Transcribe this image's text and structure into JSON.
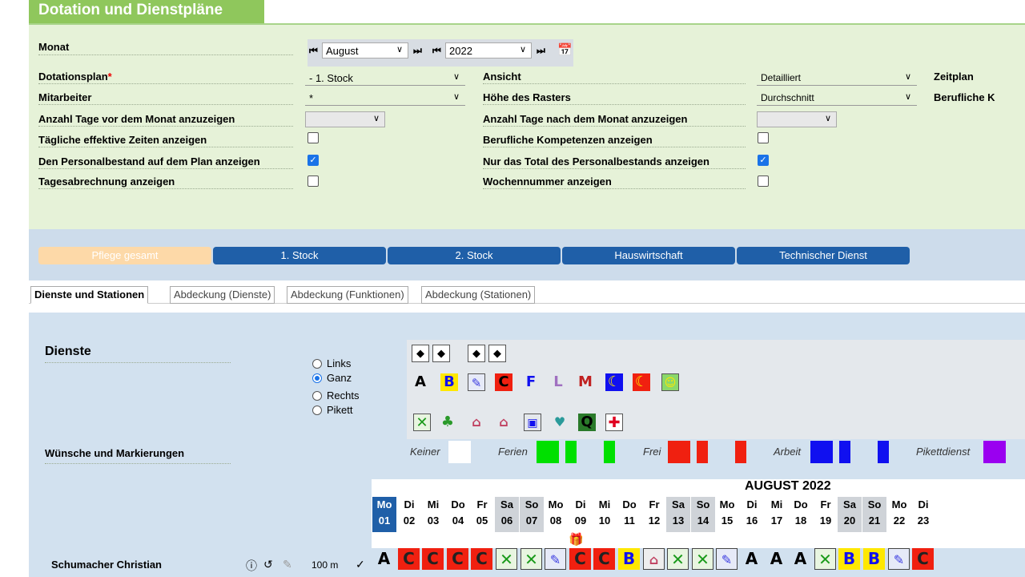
{
  "title": "Dotation und Dienstpläne",
  "filters": {
    "month_label": "Monat",
    "month_value": "August",
    "year_value": "2022",
    "plan_label": "Dotationsplan",
    "plan_required": "*",
    "plan_value": "- 1. Stock",
    "staff_label": "Mitarbeiter",
    "staff_value": "*",
    "days_before_label": "Anzahl Tage vor dem Monat anzuzeigen",
    "daily_times_label": "Tägliche effektive Zeiten anzeigen",
    "headcount_label": "Den Personalbestand auf dem Plan anzeigen",
    "daily_billing_label": "Tagesabrechnung anzeigen",
    "view_label": "Ansicht",
    "view_value": "Detailliert",
    "grid_height_label": "Höhe des Rasters",
    "grid_height_value": "Durchschnitt",
    "days_after_label": "Anzahl Tage nach dem Monat anzuzeigen",
    "competences_label": "Berufliche Kompetenzen anzeigen",
    "total_only_label": "Nur das Total des Personalbestands anzeigen",
    "week_number_label": "Wochennummer anzeigen",
    "schedule_label": "Zeitplan",
    "professional_label": "Berufliche K"
  },
  "groups": [
    "Pflege gesamt",
    "1. Stock",
    "2. Stock",
    "Hauswirtschaft",
    "Technischer Dienst"
  ],
  "tabs": [
    "Dienste und Stationen",
    "Abdeckung (Dienste)",
    "Abdeckung (Funktionen)",
    "Abdeckung (Stationen)"
  ],
  "services": {
    "title": "Dienste",
    "radios": [
      "Links",
      "Ganz",
      "Rechts",
      "Pikett"
    ],
    "wishes_label": "Wünsche und Markierungen",
    "legend": [
      "Keiner",
      "Ferien",
      "Frei",
      "Arbeit",
      "Pikettdienst"
    ],
    "shift_letters": [
      "A",
      "B",
      "C",
      "F",
      "L",
      "M",
      "Q"
    ]
  },
  "calendar": {
    "month_title": "AUGUST 2022",
    "days": [
      {
        "wd": "Mo",
        "d": "01"
      },
      {
        "wd": "Di",
        "d": "02"
      },
      {
        "wd": "Mi",
        "d": "03"
      },
      {
        "wd": "Do",
        "d": "04"
      },
      {
        "wd": "Fr",
        "d": "05"
      },
      {
        "wd": "Sa",
        "d": "06"
      },
      {
        "wd": "So",
        "d": "07"
      },
      {
        "wd": "Mo",
        "d": "08"
      },
      {
        "wd": "Di",
        "d": "09"
      },
      {
        "wd": "Mi",
        "d": "10"
      },
      {
        "wd": "Do",
        "d": "11"
      },
      {
        "wd": "Fr",
        "d": "12"
      },
      {
        "wd": "Sa",
        "d": "13"
      },
      {
        "wd": "So",
        "d": "14"
      },
      {
        "wd": "Mo",
        "d": "15"
      },
      {
        "wd": "Di",
        "d": "16"
      },
      {
        "wd": "Mi",
        "d": "17"
      },
      {
        "wd": "Do",
        "d": "18"
      },
      {
        "wd": "Fr",
        "d": "19"
      },
      {
        "wd": "Sa",
        "d": "20"
      },
      {
        "wd": "So",
        "d": "21"
      },
      {
        "wd": "Mo",
        "d": "22"
      },
      {
        "wd": "Di",
        "d": "23"
      }
    ],
    "staff": {
      "name": "Schumacher Christian",
      "percent": "100",
      "unit": "m",
      "shifts": [
        "A",
        "C",
        "C",
        "C",
        "C",
        "X",
        "X",
        "P",
        "C",
        "C",
        "B",
        "H",
        "X",
        "X",
        "P",
        "A",
        "A",
        "A",
        "X",
        "B",
        "B",
        "P",
        "C"
      ]
    }
  },
  "colors": {
    "header_green": "#8fc75c",
    "panel_green": "#e6f2d8",
    "blue_button": "#1f5fa8",
    "active_group": "#fdd9a8"
  }
}
